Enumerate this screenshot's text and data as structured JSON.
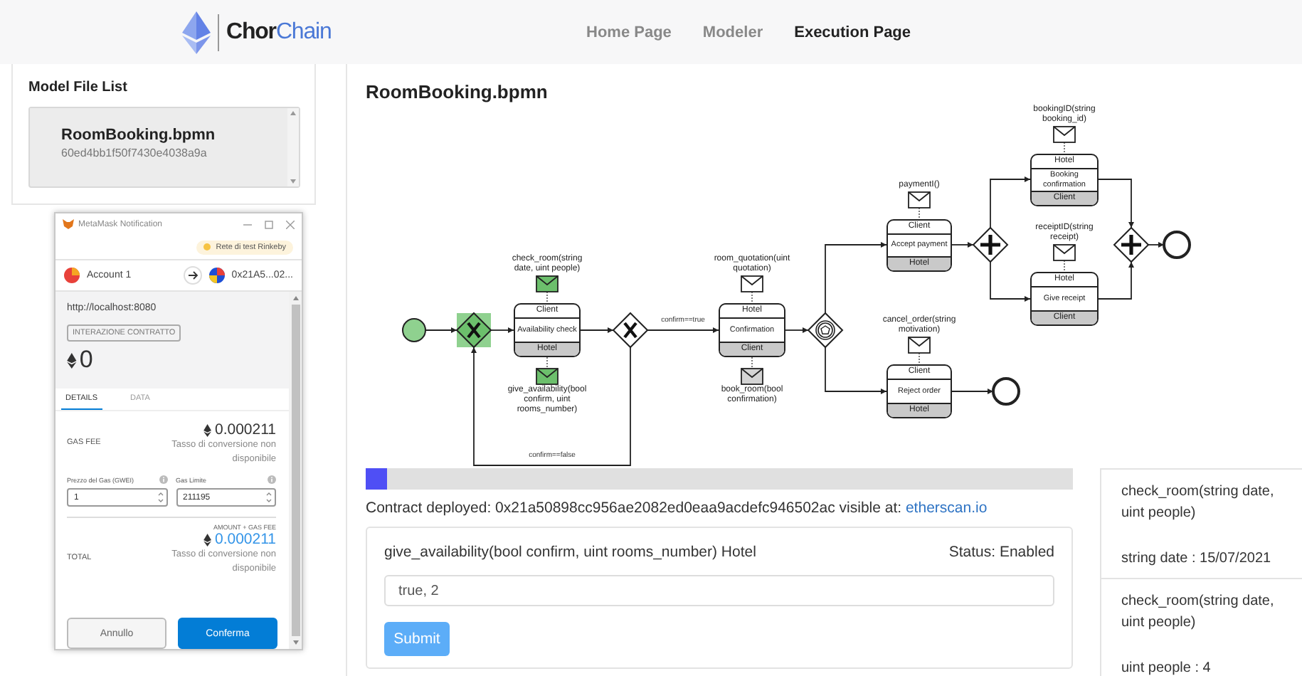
{
  "header": {
    "logo": "**Chor**Chain",
    "nav": [
      {
        "label": "Home Page",
        "selected": false
      },
      {
        "label": "Modeler",
        "selected": false
      },
      {
        "label": "Execution Page",
        "selected": true
      }
    ]
  },
  "model_file_list": {
    "title": "Model File List",
    "files": [
      {
        "name": "RoomBooking.bpmn",
        "id": "60ed4bb1f50f7430e4038a9a",
        "selected": true
      }
    ]
  },
  "metamask": {
    "window_title": "MetaMask Notification",
    "network": "Rete di test Rinkeby",
    "account": "Account 1",
    "recipient": "0x21A5...02...",
    "origin": "http://localhost:8080",
    "badge": "INTERAZIONE CONTRATTO",
    "amount": "0",
    "tabs": [
      {
        "label": "DETAILS",
        "selected": true
      },
      {
        "label": "DATA",
        "selected": false
      }
    ],
    "gas_fee": {
      "label": "GAS FEE",
      "value": "0.000211",
      "note": "Tasso di conversione non disponibile"
    },
    "gas_price": {
      "label": "Prezzo del Gas (GWEI)",
      "value": "1"
    },
    "gas_limit": {
      "label": "Gas Limite",
      "value": "211195"
    },
    "total": {
      "caption": "AMOUNT + GAS FEE",
      "label": "TOTAL",
      "value": "0.000211",
      "note": "Tasso di conversione non disponibile"
    },
    "buttons": [
      {
        "label": "Annullo",
        "kind": "secondary"
      },
      {
        "label": "Conferma",
        "kind": "primary"
      }
    ]
  },
  "execution": {
    "title": "RoomBooking.bpmn",
    "diagram": {
      "nodes": [
        {
          "kind": "start",
          "done": true
        },
        {
          "kind": "exclusive",
          "done": true
        },
        {
          "kind": "task",
          "top": "Client",
          "name": "Availability check",
          "bottom": "Hotel",
          "top_message": {
            "label": "check_room(string date, uint people)",
            "done": true
          },
          "bottom_message": {
            "label": "give_availability(bool confirm, uint rooms_number)",
            "done": true
          }
        },
        {
          "kind": "exclusive",
          "done": false
        },
        {
          "kind": "task",
          "top": "Hotel",
          "name": "Confirmation",
          "bottom": "Client",
          "top_message": {
            "label": "room_quotation(uint quotation)",
            "done": false
          },
          "bottom_message": {
            "label": "book_room(bool confirmation)",
            "done": false
          }
        },
        {
          "kind": "event_based",
          "done": false
        },
        {
          "kind": "task",
          "top": "Client",
          "name": "Accept payment",
          "bottom": "Hotel",
          "top_message": {
            "label": "paymentI()",
            "done": false
          }
        },
        {
          "kind": "task",
          "top": "Client",
          "name": "Reject order",
          "bottom": "Hotel",
          "top_message": {
            "label": "cancel_order(string motivation)",
            "done": false
          }
        },
        {
          "kind": "end",
          "done": false
        },
        {
          "kind": "parallel",
          "done": false
        },
        {
          "kind": "task",
          "top": "Hotel",
          "name": "Booking confirmation",
          "bottom": "Client",
          "top_message": {
            "label": "bookingID(string booking_id)",
            "done": false
          }
        },
        {
          "kind": "task",
          "top": "Hotel",
          "name": "Give receipt",
          "bottom": "Client",
          "top_message": {
            "label": "receiptID(string receipt)",
            "done": false
          }
        },
        {
          "kind": "parallel",
          "done": false
        },
        {
          "kind": "end",
          "done": false
        }
      ],
      "flow_labels": [
        {
          "label": "confirm==true"
        },
        {
          "label": "confirm==false"
        }
      ]
    },
    "progress": {
      "level": 0.03
    },
    "contract": {
      "text": "Contract deployed: 0x21a50898cc956ae2082ed0eaa9acdefc946502ac visible at:",
      "link": "etherscan.io"
    },
    "task_form": {
      "function": "give_availability(bool confirm, uint rooms_number) Hotel",
      "status": "Status: Enabled",
      "value": "true, 2",
      "button": "Submit"
    },
    "log": [
      {
        "function": "check_room(string date, uint people)",
        "param": "string date : 15/07/2021"
      },
      {
        "function": "check_room(string date, uint people)",
        "param": "uint people : 4"
      }
    ]
  }
}
